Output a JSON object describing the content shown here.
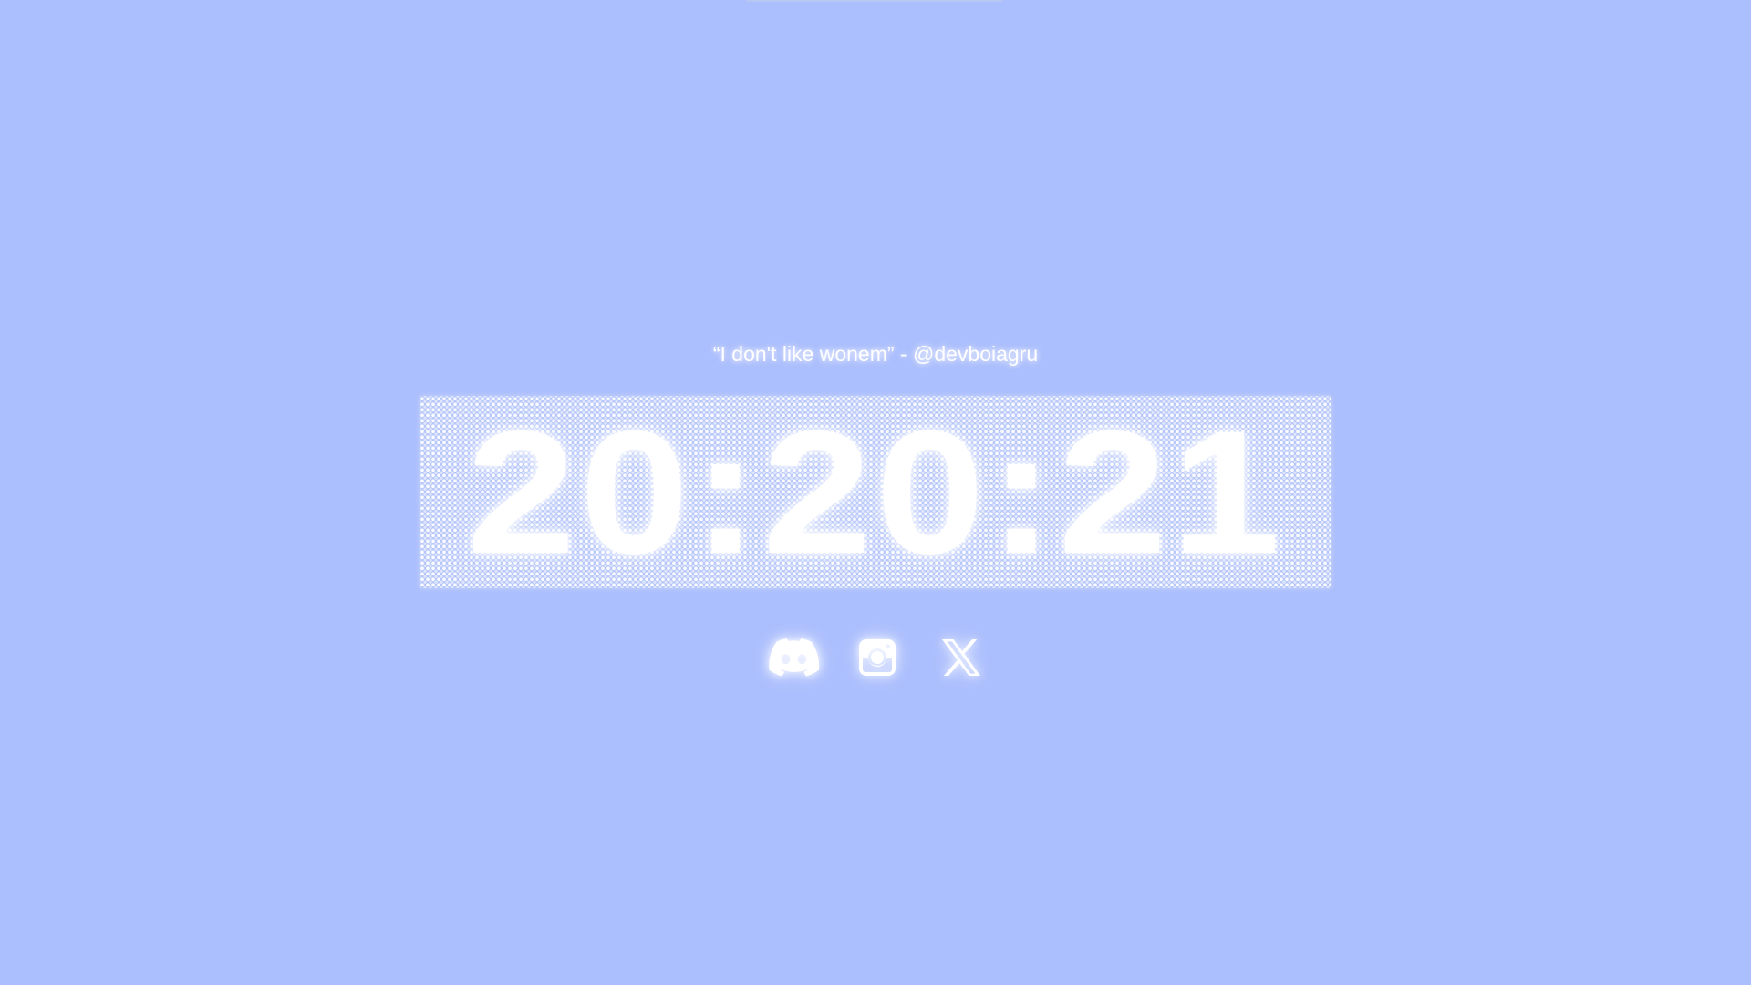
{
  "quote": {
    "text": "“I don't like wonem” - @devboiagru"
  },
  "clock": {
    "time": "20:20:21"
  },
  "socials": [
    {
      "icon": "discord-icon"
    },
    {
      "icon": "instagram-icon"
    },
    {
      "icon": "x-icon"
    }
  ],
  "colors": {
    "background": "#abbefd",
    "text": "#ffffff"
  }
}
